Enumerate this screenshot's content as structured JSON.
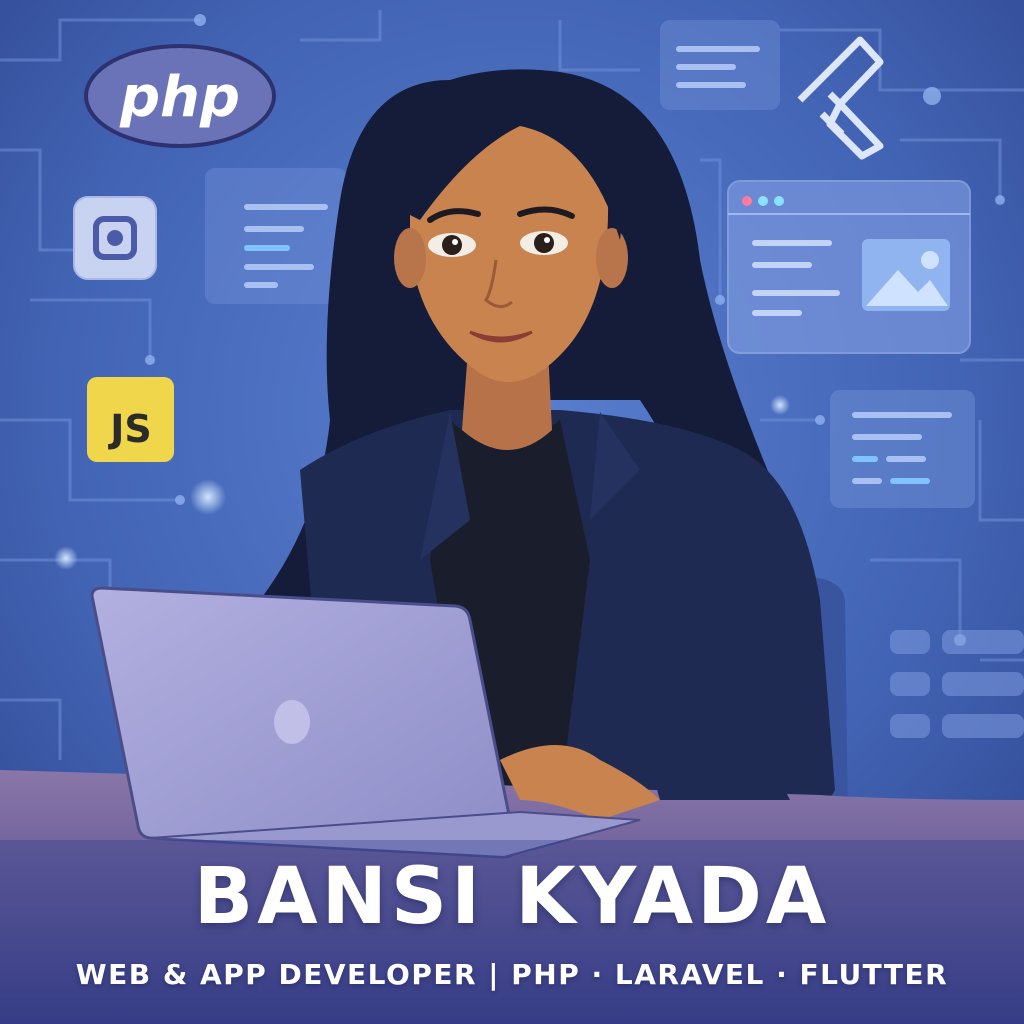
{
  "profile": {
    "name": "BANSI KYADA",
    "tagline": "WEB & APP DEVELOPER | PHP · LARAVEL · FLUTTER"
  },
  "tech_logos": {
    "php_label": "php",
    "js_label": "JS"
  },
  "icons": [
    "php-logo",
    "flutter-logo-icon",
    "app-icon",
    "javascript-badge",
    "laptop-icon",
    "image-icon"
  ],
  "colors": {
    "background": "#3d5dae",
    "circuit_lines": "#6f8fd8",
    "js_yellow": "#f0d64a",
    "php_purple": "#6a72b8",
    "jacket": "#1e2a52",
    "laptop": "#a3a3d6",
    "text": "#ffffff"
  }
}
